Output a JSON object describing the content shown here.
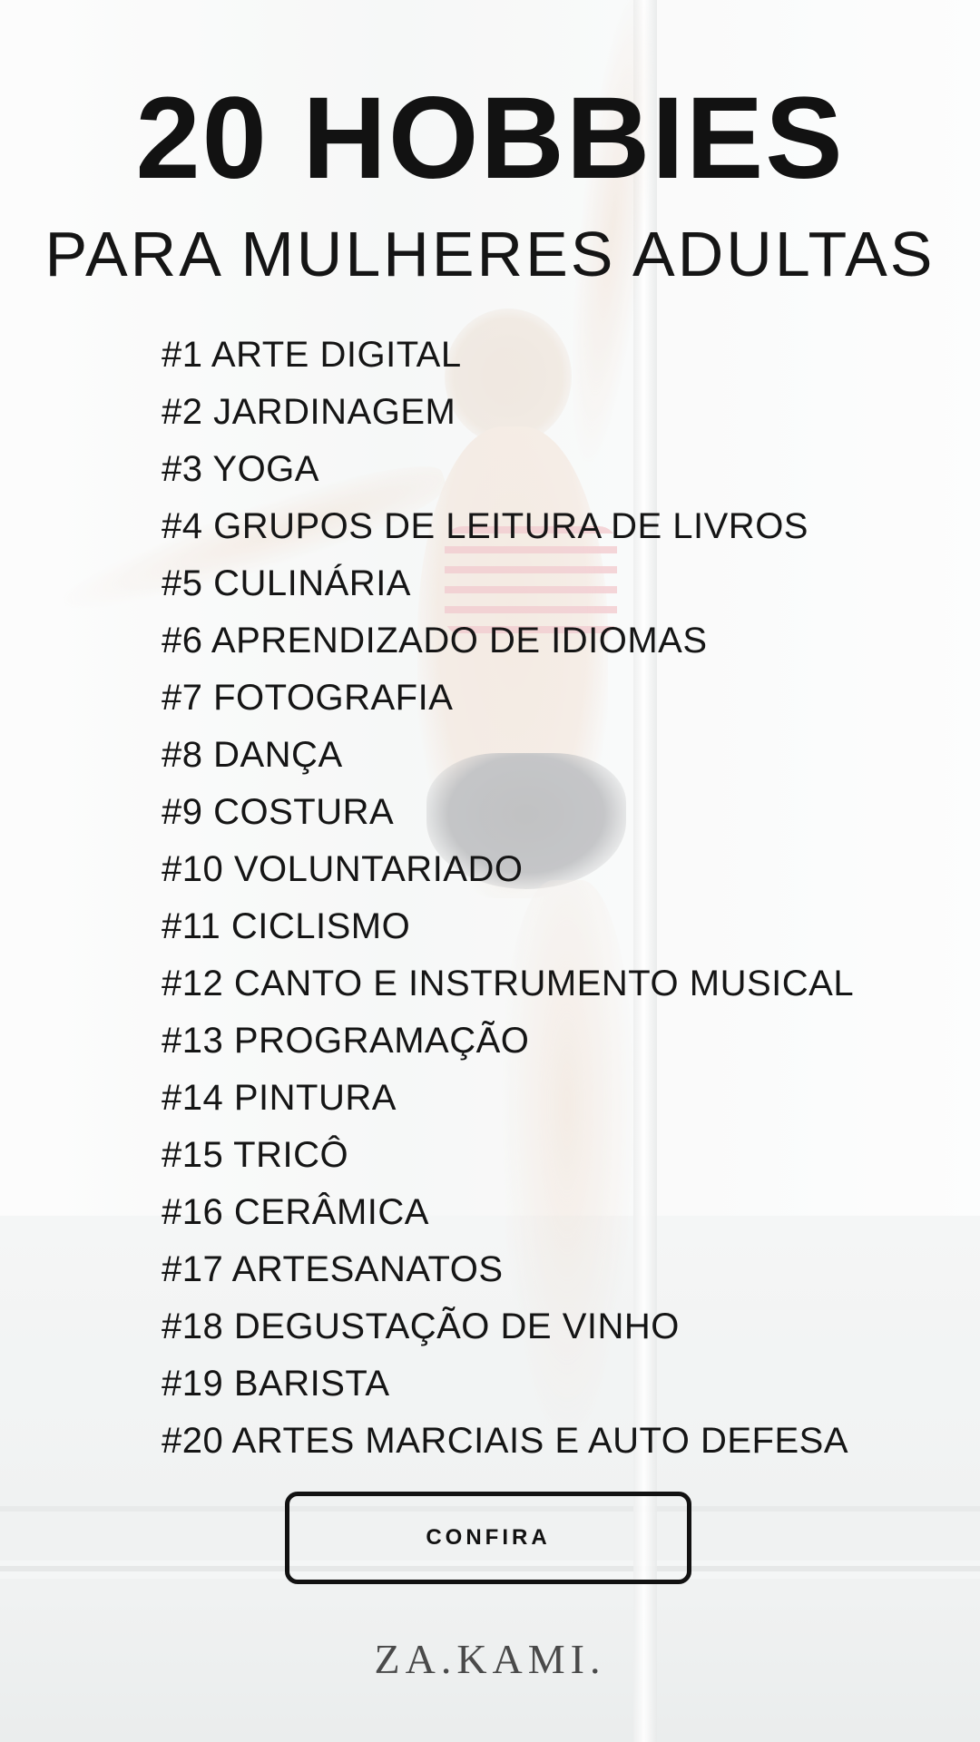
{
  "header": {
    "title": "20 HOBBIES",
    "subtitle": "PARA MULHERES ADULTAS"
  },
  "hobbies": [
    "#1 ARTE DIGITAL",
    "#2 JARDINAGEM",
    "#3 YOGA",
    "#4 GRUPOS DE LEITURA DE LIVROS",
    "#5 CULINÁRIA",
    "#6 APRENDIZADO DE IDIOMAS",
    "#7 FOTOGRAFIA",
    "#8 DANÇA",
    "#9 COSTURA",
    "#10 VOLUNTARIADO",
    "#11 CICLISMO",
    "#12 CANTO E INSTRUMENTO MUSICAL",
    "#13 PROGRAMAÇÃO",
    "#14 PINTURA",
    "#15 TRICÔ",
    "#16 CERÂMICA",
    "#17 ARTESANATOS",
    "#18 DEGUSTAÇÃO DE VINHO",
    "#19 BARISTA",
    "#20 ARTES MARCIAIS E AUTO DEFESA"
  ],
  "cta": {
    "label": "CONFIRA"
  },
  "footer": {
    "brand": "ZA.KAMI."
  },
  "colors": {
    "text": "#121212",
    "background": "#f7f8f8",
    "brand": "#4a4a4a"
  }
}
